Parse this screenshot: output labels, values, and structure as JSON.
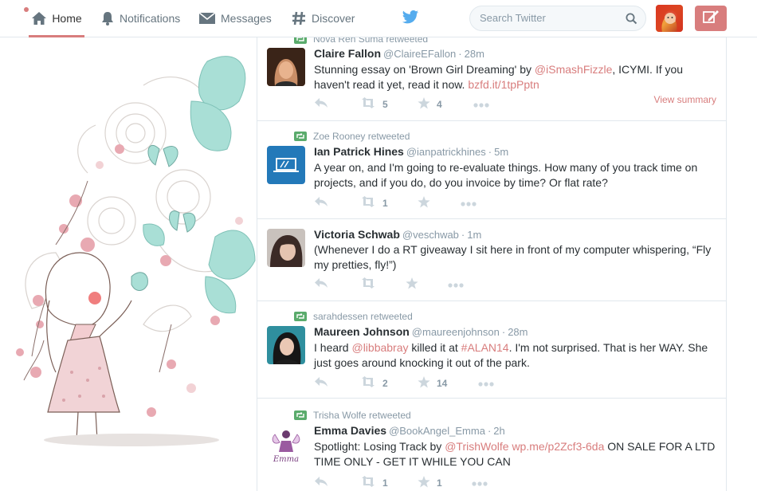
{
  "nav": {
    "home": "Home",
    "notifications": "Notifications",
    "messages": "Messages",
    "discover": "Discover"
  },
  "search": {
    "placeholder": "Search Twitter"
  },
  "colors": {
    "accent": "#d87d7d",
    "retweet": "#5aab6c",
    "twitter_blue": "#55acee",
    "muted": "#8899a6"
  },
  "tweets": [
    {
      "context": "Nova Ren Suma retweeted",
      "name": "Claire Fallon",
      "handle": "@ClaireEFallon",
      "time": "28m",
      "text_parts": [
        {
          "t": "Stunning essay on 'Brown Girl Dreaming' by "
        },
        {
          "t": "@iSmashFizzle",
          "link": true
        },
        {
          "t": ", ICYMI. If you haven't read it yet, read it now. "
        },
        {
          "t": "bzfd.it/1tpPptn",
          "link": true
        }
      ],
      "retweets": "5",
      "favorites": "4",
      "summary": "View summary"
    },
    {
      "context": "Zoe Rooney retweeted",
      "name": "Ian Patrick Hines",
      "handle": "@ianpatrickhines",
      "time": "5m",
      "text_parts": [
        {
          "t": "A year on, and I'm going to re-evaluate things. How many of you track time on projects, and if you do, do you invoice by time? Or flat rate?"
        }
      ],
      "retweets": "1",
      "favorites": ""
    },
    {
      "context": "",
      "name": "Victoria Schwab",
      "handle": "@veschwab",
      "time": "1m",
      "text_parts": [
        {
          "t": "(Whenever I do a RT giveaway I sit here in front of my computer whispering, “Fly my pretties, fly!”)"
        }
      ],
      "retweets": "",
      "favorites": ""
    },
    {
      "context": "sarahdessen retweeted",
      "name": "Maureen Johnson",
      "handle": "@maureenjohnson",
      "time": "28m",
      "text_parts": [
        {
          "t": "I heard "
        },
        {
          "t": "@libbabray",
          "link": true
        },
        {
          "t": " killed it at "
        },
        {
          "t": "#ALAN14",
          "link": true
        },
        {
          "t": ". I'm not surprised. That is her WAY. She just goes around knocking it out of the park."
        }
      ],
      "retweets": "2",
      "favorites": "14"
    },
    {
      "context": "Trisha Wolfe retweeted",
      "name": "Emma Davies",
      "handle": "@BookAngel_Emma",
      "time": "2h",
      "text_parts": [
        {
          "t": "Spotlight: Losing Track by "
        },
        {
          "t": "@TrishWolfe",
          "link": true
        },
        {
          "t": " "
        },
        {
          "t": "wp.me/p2Zcf3-6da",
          "link": true
        },
        {
          "t": " ON SALE FOR A LTD TIME ONLY - GET IT WHILE YOU CAN"
        }
      ],
      "retweets": "1",
      "favorites": "1",
      "avatar_label": "Emma"
    }
  ]
}
